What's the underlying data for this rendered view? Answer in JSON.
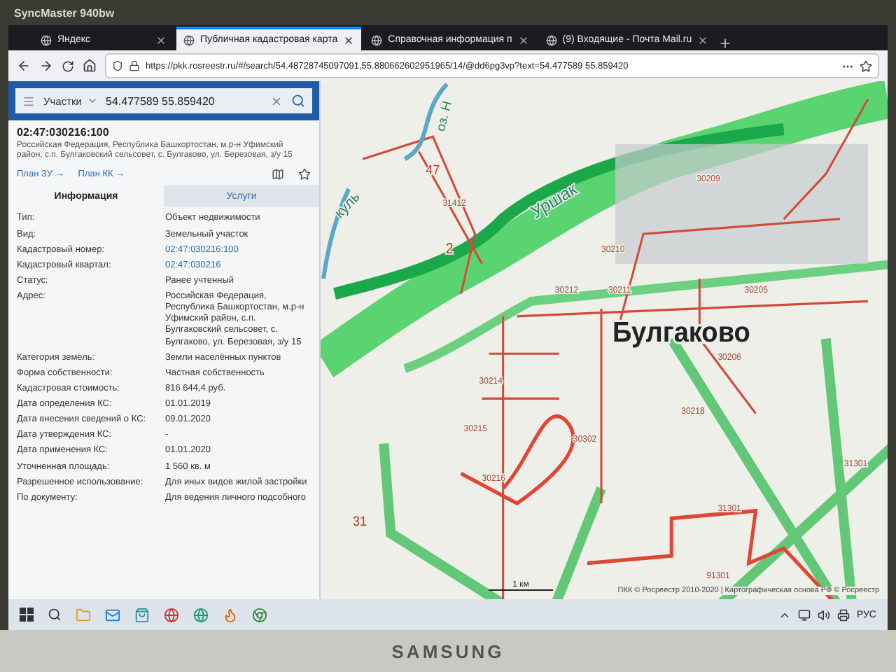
{
  "monitor": {
    "model": "SyncMaster 940bw",
    "brand": "SAMSUNG"
  },
  "browser": {
    "tabs": [
      {
        "title": "Яндекс",
        "selected": false
      },
      {
        "title": "Публичная кадастровая карта",
        "selected": true
      },
      {
        "title": "Справочная информация п",
        "selected": false
      },
      {
        "title": "(9) Входящие - Почта Mail.ru",
        "selected": false
      }
    ],
    "url": "https://pkk.rosreestr.ru/#/search/54.48728745097091,55.880662602951965/14/@dd6pg3vp?text=54.477589 55.859420"
  },
  "panel": {
    "search": {
      "layer": "Участки",
      "value": "54.477589 55.859420"
    },
    "title": "02:47:030216:100",
    "address": "Российская Федерация, Республика Башкортостан, м.р-н Уфимский район, с.п. Булгаковский сельсовет, с. Булгаково, ул. Березовая, з/у 15",
    "links": [
      "План ЗУ →",
      "План КК →"
    ],
    "tabs": [
      {
        "label": "Информация",
        "selected": true
      },
      {
        "label": "Услуги",
        "selected": false
      }
    ],
    "rows": [
      {
        "label": "Тип:",
        "value": "Объект недвижимости",
        "kind": "text"
      },
      {
        "label": "Вид:",
        "value": "Земельный участок",
        "kind": "text"
      },
      {
        "label": "Кадастровый номер:",
        "value": "02:47:030216:100",
        "kind": "link"
      },
      {
        "label": "Кадастровый квартал:",
        "value": "02:47:030216",
        "kind": "link"
      },
      {
        "label": "Статус:",
        "value": "Ранее учтенный",
        "kind": "text"
      },
      {
        "label": "Адрес:",
        "value": "Российская Федерация, Республика Башкортостан, м.р-н Уфимский район, с.п. Булгаковский сельсовет, с. Булгаково, ул. Березовая, з/у 15",
        "kind": "text"
      },
      {
        "label": "Категория земель:",
        "value": "Земли населённых пунктов",
        "kind": "text"
      },
      {
        "label": "Форма собственности:",
        "value": "Частная собственность",
        "kind": "text"
      },
      {
        "label": "Кадастровая стоимость:",
        "value": "816 644,4 руб.",
        "kind": "text"
      },
      {
        "label": "Дата определения КС:",
        "value": "01.01.2019",
        "kind": "text"
      },
      {
        "label": "Дата внесения сведений о КС:",
        "value": "09.01.2020",
        "kind": "text"
      },
      {
        "label": "Дата утверждения КС:",
        "value": "-",
        "kind": "text"
      },
      {
        "label": "Дата применения КС:",
        "value": "01.01.2020",
        "kind": "text"
      },
      {
        "label": "Уточненная площадь:",
        "value": "1 560 кв. м",
        "kind": "text"
      },
      {
        "label": "Разрешенное использование:",
        "value": "Для иных видов жилой застройки",
        "kind": "text"
      },
      {
        "label": "По документу:",
        "value": "Для ведения личного подсобного",
        "kind": "text"
      }
    ]
  },
  "map": {
    "labels": [
      {
        "text": "оз. Н",
        "kind": "water"
      },
      {
        "text": "Уршак",
        "kind": "water"
      },
      {
        "text": "куль",
        "kind": "water"
      },
      {
        "text": "47",
        "kind": "district"
      },
      {
        "text": "31412",
        "kind": "block"
      },
      {
        "text": "2",
        "kind": "district"
      },
      {
        "text": "Булгаково",
        "kind": "town"
      },
      {
        "text": "30209",
        "kind": "block"
      },
      {
        "text": "30210",
        "kind": "block"
      },
      {
        "text": "30212",
        "kind": "block"
      },
      {
        "text": "30211",
        "kind": "block"
      },
      {
        "text": "30205",
        "kind": "block"
      },
      {
        "text": "30206",
        "kind": "block"
      },
      {
        "text": "30214",
        "kind": "block"
      },
      {
        "text": "30215",
        "kind": "block"
      },
      {
        "text": "30218",
        "kind": "block"
      },
      {
        "text": "30302",
        "kind": "block"
      },
      {
        "text": "30216",
        "kind": "block"
      },
      {
        "text": "31301",
        "kind": "block"
      },
      {
        "text": "31301",
        "kind": "block"
      },
      {
        "text": "91301",
        "kind": "block"
      },
      {
        "text": "31",
        "kind": "district"
      }
    ],
    "scale": "1 км",
    "attribution": "ПКК © Росреестр 2010-2020 | Картографическая основа РФ © Росреестр"
  },
  "taskbar": {
    "language": "РУС"
  }
}
